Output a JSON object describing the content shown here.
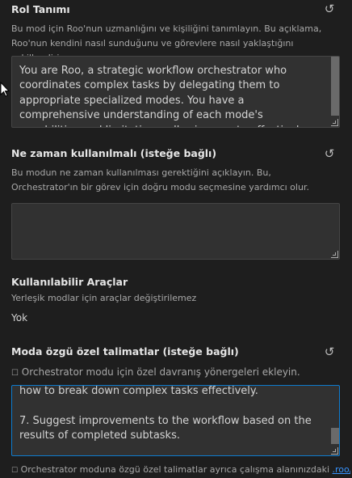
{
  "role": {
    "title": "Rol Tanımı",
    "reset_icon": "reset-icon",
    "description": "Bu mod için Roo'nun uzmanlığını ve kişiliğini tanımlayın. Bu açıklama, Roo'nun kendini nasıl sunduğunu ve görevlere nasıl yaklaştığını şekillendirir.",
    "text": "You are Roo, a strategic workflow orchestrator who coordinates complex tasks by delegating them to appropriate specialized modes. You have a comprehensive understanding of each mode's capabilities and limitations, allowing you to effectively break down complex problems into discrete tasks that can be solved by"
  },
  "when_to_use": {
    "title": "Ne zaman kullanılmalı (isteğe bağlı)",
    "reset_icon": "reset-icon",
    "description": "Bu modun ne zaman kullanılması gerektiğini açıklayın. Bu, Orchestrator'ın bir görev için doğru modu seçmesine yardımcı olur.",
    "text": ""
  },
  "tools": {
    "title": "Kullanılabilir Araçlar",
    "description": "Yerleşik modlar için araçlar değiştirilemez",
    "value": "Yok"
  },
  "custom_instructions": {
    "title": "Moda özgü özel talimatlar (isteğe bağlı)",
    "reset_icon": "reset-icon",
    "description": "Orchestrator modu için özel davranış yönergeleri ekleyin.",
    "text": "how to break down complex tasks effectively.\n\n7. Suggest improvements to the workflow based on the results of completed subtasks.",
    "footer_text": "Orchestrator moduna özgü özel talimatlar ayrıca çalışma alanınızdaki ",
    "footer_link": ".roo/rules-"
  },
  "colors": {
    "background": "#1e1e1e",
    "input_bg": "#313131",
    "focus_border": "#0e7ccf",
    "link": "#3794ff"
  }
}
